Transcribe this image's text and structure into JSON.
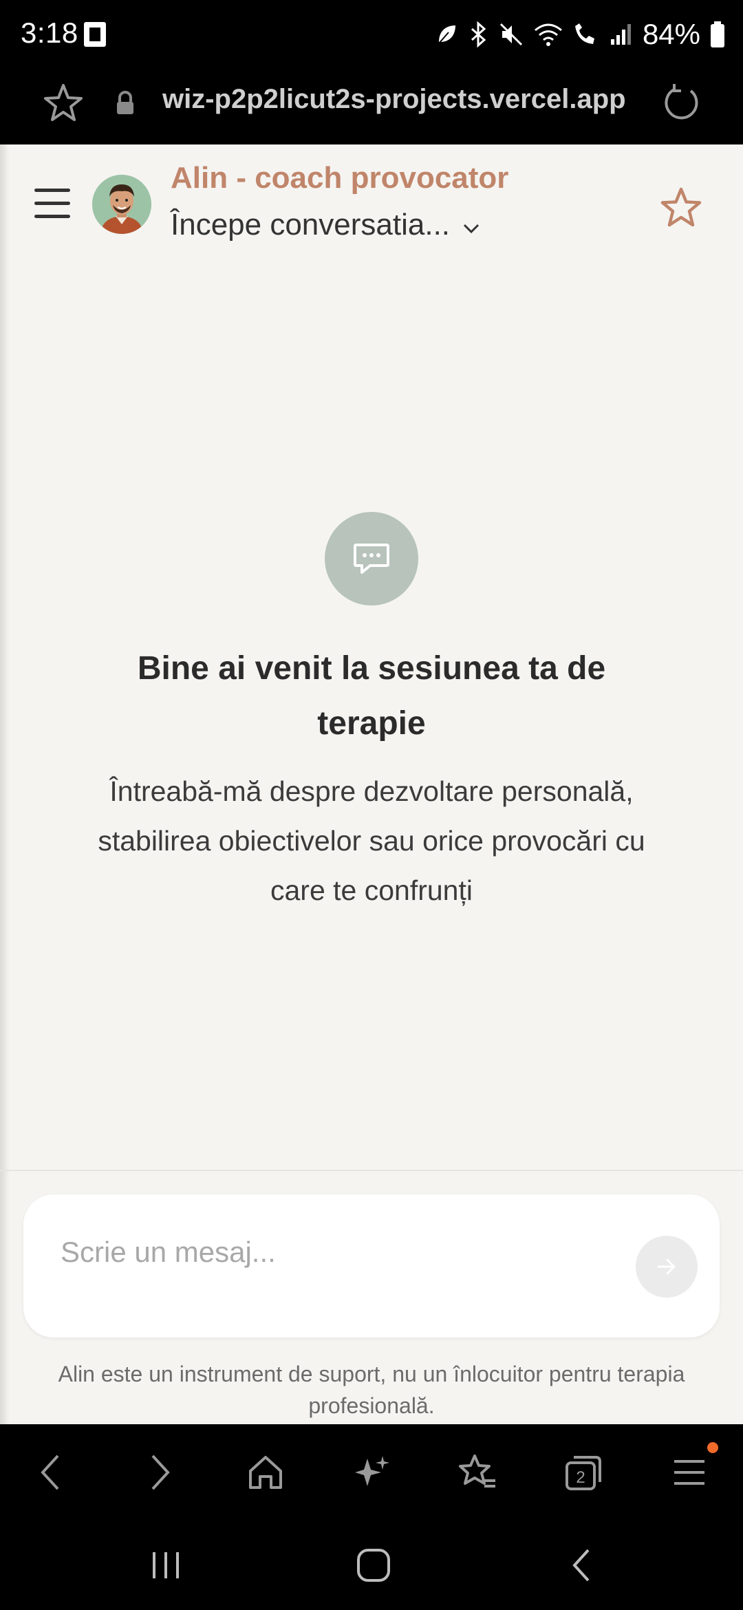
{
  "status_bar": {
    "time": "3:18",
    "battery": "84%"
  },
  "browser": {
    "url": "wiz-p2p2licut2s-projects.vercel.app",
    "tabs_count": "2"
  },
  "header": {
    "coach_name": "Alin - coach provocator",
    "conversation_select": "Începe conversatia..."
  },
  "welcome": {
    "title": "Bine ai venit la sesiunea ta de terapie",
    "subtitle": "Întreabă-mă despre dezvoltare personală, stabilirea obiectivelor sau orice provocări cu care te confrunți"
  },
  "composer": {
    "placeholder": "Scrie un mesaj..."
  },
  "disclaimer": "Alin este un instrument de suport, nu un înlocuitor pentru terapia profesională.",
  "colors": {
    "accent": "#c0856a",
    "background": "#f5f4f1",
    "welcome_icon_bg": "#b7c3bb"
  },
  "icons": {
    "status": [
      "sim-icon",
      "leaf-icon",
      "bluetooth-icon",
      "mute-icon",
      "wifi-icon",
      "wifi-call-icon",
      "signal-icon",
      "battery-icon"
    ],
    "toolbar": [
      "back-icon",
      "forward-icon",
      "home-icon",
      "sparkle-icon",
      "bookmarks-icon",
      "tabs-icon",
      "menu-icon"
    ],
    "system_nav": [
      "recents-icon",
      "home-nav-icon",
      "back-nav-icon"
    ]
  }
}
